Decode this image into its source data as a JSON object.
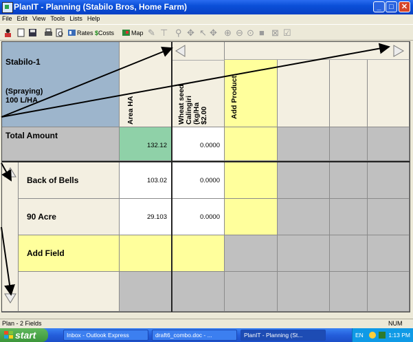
{
  "window": {
    "title": "PlanIT - Planning  (Stabilo Bros, Home Farm)",
    "minimize": "_",
    "maximize": "□",
    "close": "✕"
  },
  "menu": [
    "File",
    "Edit",
    "View",
    "Tools",
    "Lists",
    "Help"
  ],
  "toolbar": {
    "rates_label": "Rates",
    "costs_label": "Costs",
    "costs_prefix": "$",
    "map_label": "Map"
  },
  "grid": {
    "header": {
      "plan_name": "Stabilo-1",
      "plan_desc": "(Spraying)\n100 L/HA",
      "col_area": "Area HA",
      "col_product": "Wheat seed\nCalingiri (kg/Ha\n$2.00",
      "col_add_product": "Add Product"
    },
    "total": {
      "label": "Total Amount",
      "area": "132.12",
      "product": "0.0000"
    },
    "rows": [
      {
        "label": "Back of Bells",
        "area": "103.02",
        "product": "0.0000"
      },
      {
        "label": "90 Acre",
        "area": "29.103",
        "product": "0.0000"
      }
    ],
    "add_field": "Add Field"
  },
  "status": {
    "left": "Plan - 2 Fields",
    "right": "NUM"
  },
  "taskbar": {
    "start": "start",
    "tasks": [
      "Inbox - Outlook Express",
      "draft6_combo.doc - ...",
      "PlanIT - Planning  (St..."
    ],
    "lang": "EN",
    "time": "1:13 PM"
  }
}
